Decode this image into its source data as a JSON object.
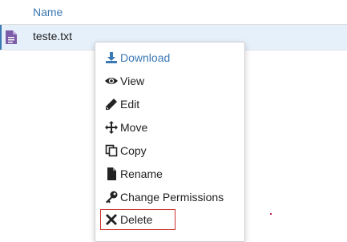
{
  "table": {
    "column_name": "Name",
    "file_name": "teste.txt",
    "file_icon": "document-icon"
  },
  "context_menu": {
    "items": [
      {
        "label": "Download",
        "icon": "download-icon"
      },
      {
        "label": "View",
        "icon": "eye-icon"
      },
      {
        "label": "Edit",
        "icon": "pencil-icon"
      },
      {
        "label": "Move",
        "icon": "move-icon"
      },
      {
        "label": "Copy",
        "icon": "copy-icon"
      },
      {
        "label": "Rename",
        "icon": "file-icon"
      },
      {
        "label": "Change Permissions",
        "icon": "key-icon"
      },
      {
        "label": "Delete",
        "icon": "close-icon"
      }
    ]
  },
  "colors": {
    "accent": "#3b79b4",
    "selected_row": "#e6f0fa",
    "file_icon": "#7b5ea7",
    "delete_outline": "#c9302c"
  }
}
